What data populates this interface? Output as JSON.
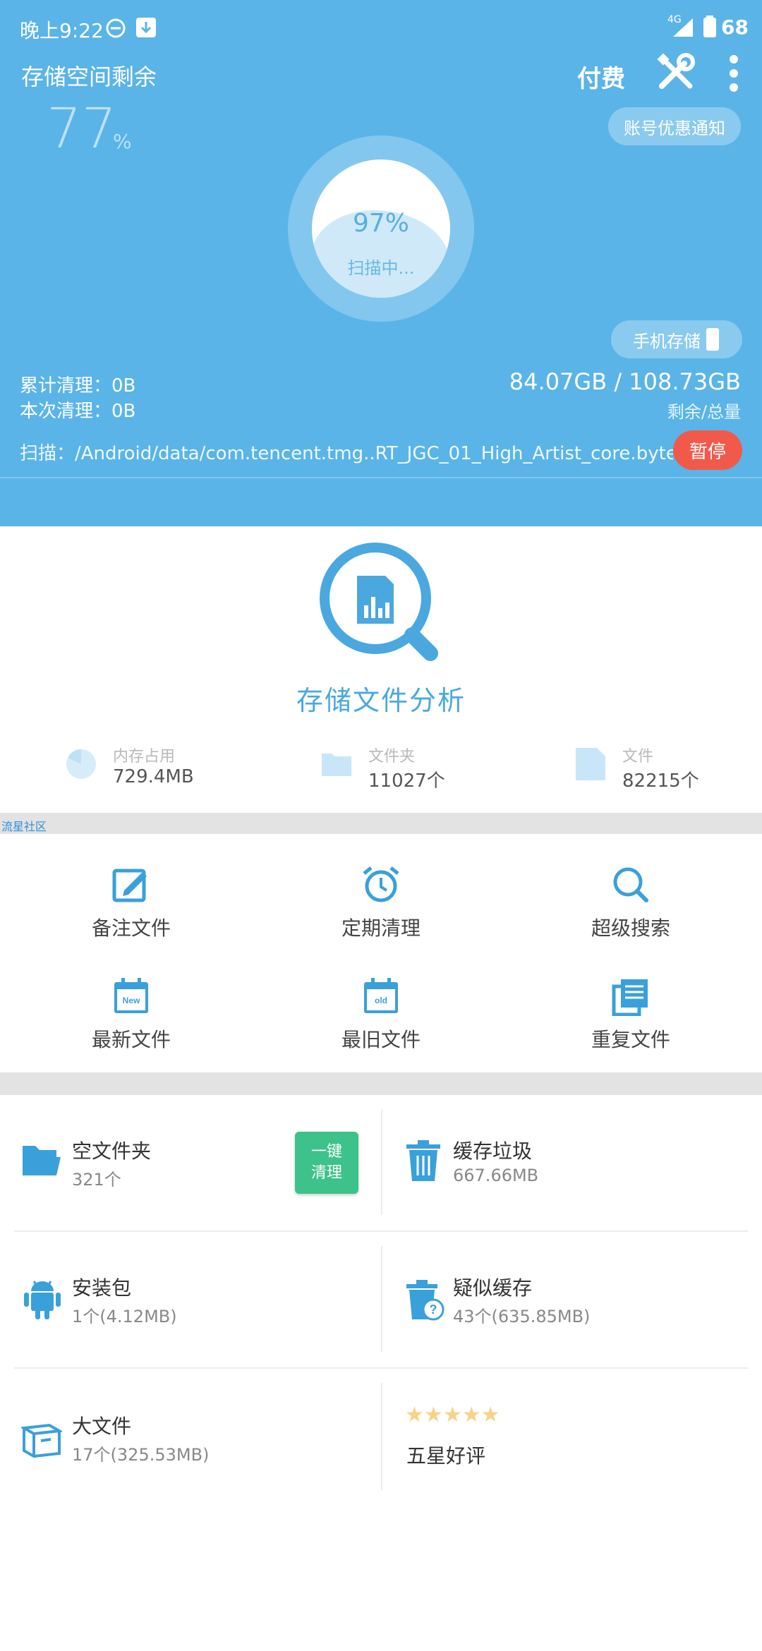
{
  "status_bar": {
    "time": "晚上9:22",
    "network": "4G",
    "battery": "68"
  },
  "header": {
    "storage_label": "存储空间剩余",
    "storage_percent": "77",
    "percent_sign": "%",
    "paid_label": "付费",
    "promo_pill": "账号优惠通知",
    "scan_progress": "97%",
    "scan_status": "扫描中...",
    "phone_storage_pill": "手机存储",
    "total_cleaned_label": "累计清理：0B",
    "this_cleaned_label": "本次清理：0B",
    "storage_values": "84.07GB / 108.73GB",
    "storage_caption": "剩余/总量",
    "scan_path": "扫描：/Android/data/com.tencent.tmg..RT_JGC_01_High_Artist_core.bytessv",
    "pause_label": "暂停",
    "colors": {
      "header_bg": "#5ab4e8",
      "pause_bg": "#f15a4a"
    }
  },
  "analysis": {
    "title": "存储文件分析",
    "stats": [
      {
        "label": "内存占用",
        "value": "729.4MB"
      },
      {
        "label": "文件夹",
        "value": "11027个"
      },
      {
        "label": "文件",
        "value": "82215个"
      }
    ]
  },
  "community_label": "流星社区",
  "tools": [
    {
      "label": "备注文件",
      "icon": "edit-icon"
    },
    {
      "label": "定期清理",
      "icon": "alarm-clock-icon"
    },
    {
      "label": "超级搜索",
      "icon": "search-icon"
    },
    {
      "label": "最新文件",
      "icon": "calendar-new-icon",
      "badge": "New"
    },
    {
      "label": "最旧文件",
      "icon": "calendar-old-icon",
      "badge": "old"
    },
    {
      "label": "重复文件",
      "icon": "duplicate-file-icon"
    }
  ],
  "cells": {
    "empty_folder": {
      "title": "空文件夹",
      "sub": "321个",
      "button_line1": "一键",
      "button_line2": "清理"
    },
    "cache_trash": {
      "title": "缓存垃圾",
      "sub": "667.66MB"
    },
    "apk": {
      "title": "安装包",
      "sub": "1个(4.12MB)"
    },
    "suspect_cache": {
      "title": "疑似缓存",
      "sub": "43个(635.85MB)"
    },
    "big_files": {
      "title": "大文件",
      "sub": "17个(325.53MB)"
    },
    "rating": {
      "title": "五星好评",
      "stars": 5
    }
  },
  "accent_color": "#3aa0da"
}
